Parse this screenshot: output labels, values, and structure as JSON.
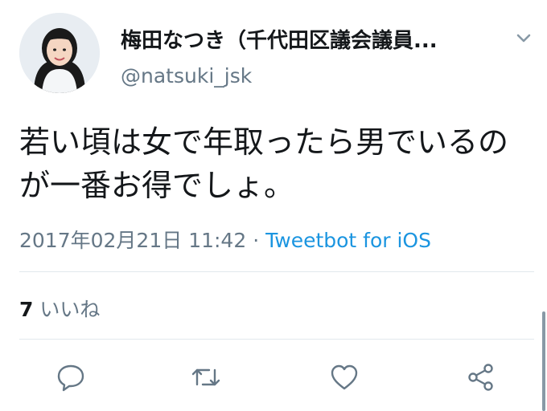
{
  "user": {
    "display_name": "梅田なつき（千代田区議会議員...",
    "handle": "@natsuki_jsk",
    "avatar_icon": "profile-photo"
  },
  "tweet": {
    "text": "若い頃は女で年取ったら男でいるのが一番お得でしょ。",
    "timestamp": "2017年02月21日 11:42",
    "separator": "·",
    "source": "Tweetbot for iOS"
  },
  "stats": {
    "likes_count": "7",
    "likes_label": "いいね"
  },
  "actions": [
    {
      "name": "reply",
      "icon": "reply-icon"
    },
    {
      "name": "retweet",
      "icon": "retweet-icon"
    },
    {
      "name": "like",
      "icon": "heart-icon"
    },
    {
      "name": "share",
      "icon": "share-icon"
    }
  ],
  "colors": {
    "text": "#14171a",
    "secondary": "#657786",
    "link": "#1b95e0",
    "divider": "#e1e8ed"
  }
}
